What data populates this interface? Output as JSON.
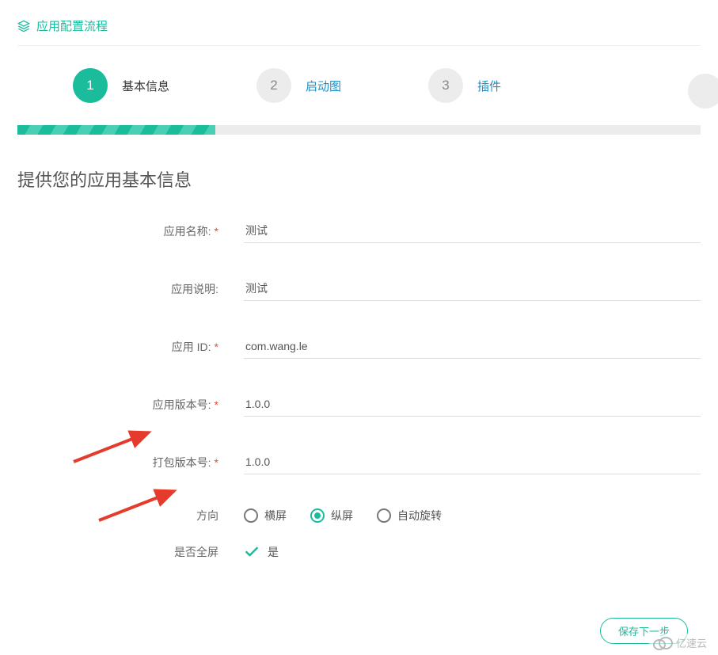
{
  "header": {
    "title": "应用配置流程"
  },
  "steps": [
    {
      "num": "1",
      "label": "基本信息",
      "active": true
    },
    {
      "num": "2",
      "label": "启动图",
      "active": false
    },
    {
      "num": "3",
      "label": "插件",
      "active": false
    }
  ],
  "section_title": "提供您的应用基本信息",
  "form": {
    "app_name": {
      "label": "应用名称:",
      "value": "测试",
      "required": true
    },
    "app_desc": {
      "label": "应用说明:",
      "value": "测试",
      "required": false
    },
    "app_id": {
      "label": "应用 ID:",
      "value": "com.wang.le",
      "required": true
    },
    "app_ver": {
      "label": "应用版本号:",
      "value": "1.0.0",
      "required": true
    },
    "pack_ver": {
      "label": "打包版本号:",
      "value": "1.0.0",
      "required": true
    },
    "orientation": {
      "label": "方向",
      "options": [
        "横屏",
        "纵屏",
        "自动旋转"
      ],
      "selected": 1
    },
    "fullscreen": {
      "label": "是否全屏",
      "value_label": "是",
      "checked": true
    }
  },
  "actions": {
    "save_label": "保存下一步"
  },
  "watermark": "亿速云"
}
